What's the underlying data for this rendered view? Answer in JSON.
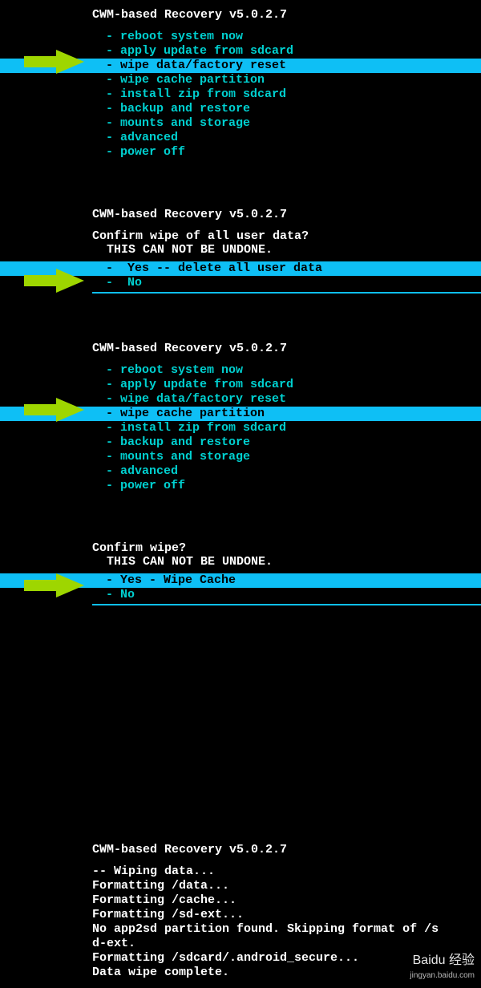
{
  "colors": {
    "accent": "#0ebff5",
    "text_cyan": "#00d0d0",
    "arrow": "#9ed600"
  },
  "panels": [
    {
      "header": "CWM-based Recovery v5.0.2.7",
      "type": "menu",
      "selected_index": 2,
      "items": [
        "- reboot system now",
        "- apply update from sdcard",
        "- wipe data/factory reset",
        "- wipe cache partition",
        "- install zip from sdcard",
        "- backup and restore",
        "- mounts and storage",
        "- advanced",
        "- power off"
      ]
    },
    {
      "header": "CWM-based Recovery v5.0.2.7",
      "type": "confirm",
      "message": "Confirm wipe of all user data?",
      "warning": "  THIS CAN NOT BE UNDONE.",
      "selected_index": 0,
      "items": [
        "-  Yes -- delete all user data",
        "-  No"
      ]
    },
    {
      "header": "CWM-based Recovery v5.0.2.7",
      "type": "menu",
      "selected_index": 3,
      "items": [
        "- reboot system now",
        "- apply update from sdcard",
        "- wipe data/factory reset",
        "- wipe cache partition",
        "- install zip from sdcard",
        "- backup and restore",
        "- mounts and storage",
        "- advanced",
        "- power off"
      ]
    },
    {
      "header": "",
      "type": "confirm",
      "message": "Confirm wipe?",
      "warning": "  THIS CAN NOT BE UNDONE.",
      "selected_index": 0,
      "items": [
        "- Yes - Wipe Cache",
        "- No"
      ]
    },
    {
      "header": "CWM-based Recovery v5.0.2.7",
      "type": "log",
      "lines": [
        "-- Wiping data...",
        "Formatting /data...",
        "Formatting /cache...",
        "Formatting /sd-ext...",
        "No app2sd partition found. Skipping format of /s",
        "d-ext.",
        "Formatting /sdcard/.android_secure...",
        "Data wipe complete."
      ]
    }
  ],
  "watermark": {
    "brand": "Baidu 经验",
    "url": "jingyan.baidu.com"
  }
}
